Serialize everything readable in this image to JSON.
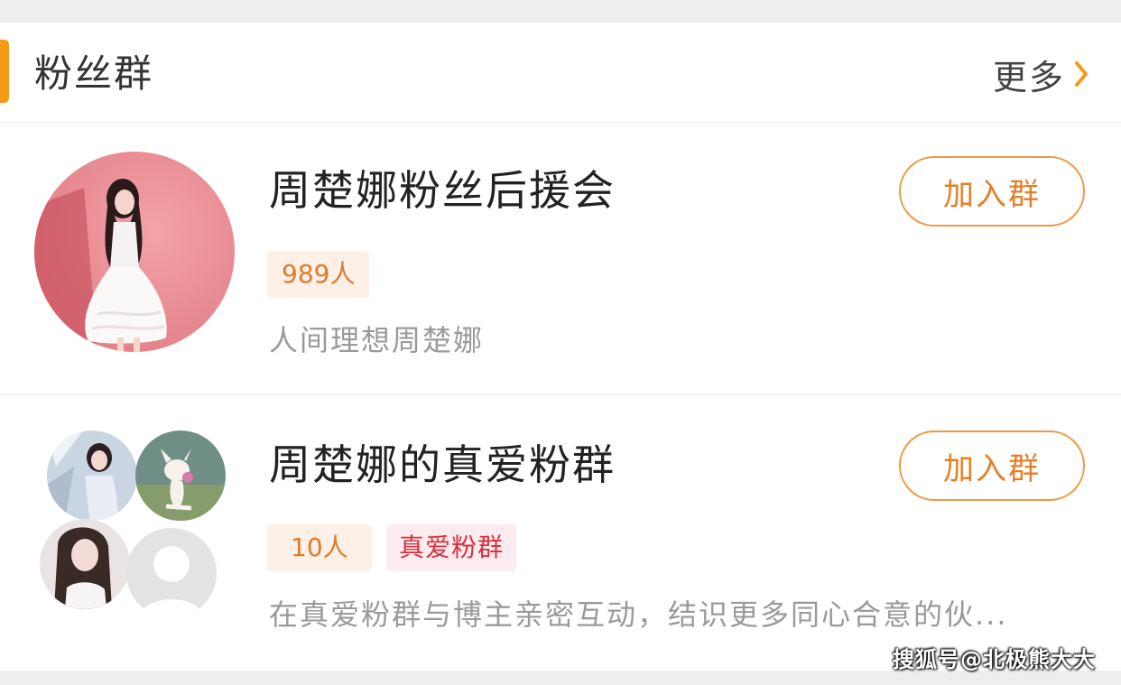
{
  "header": {
    "title": "粉丝群",
    "more_label": "更多"
  },
  "groups": [
    {
      "name": "周楚娜粉丝后援会",
      "member_count": "989人",
      "tag": "",
      "description": "人间理想周楚娜",
      "join_label": "加入群"
    },
    {
      "name": "周楚娜的真爱粉群",
      "member_count": "10人",
      "tag": "真爱粉群",
      "description": "在真爱粉群与博主亲密互动，结识更多同心合意的伙...",
      "join_label": "加入群"
    }
  ],
  "watermark": "搜狐号@北极熊大大",
  "colors": {
    "accent": "#f59a15",
    "join_border": "#ee9a45",
    "count_badge_bg": "#fdf0e6",
    "count_badge_text": "#e07a2c",
    "love_badge_bg": "#fdecef",
    "love_badge_text": "#d9303e"
  }
}
